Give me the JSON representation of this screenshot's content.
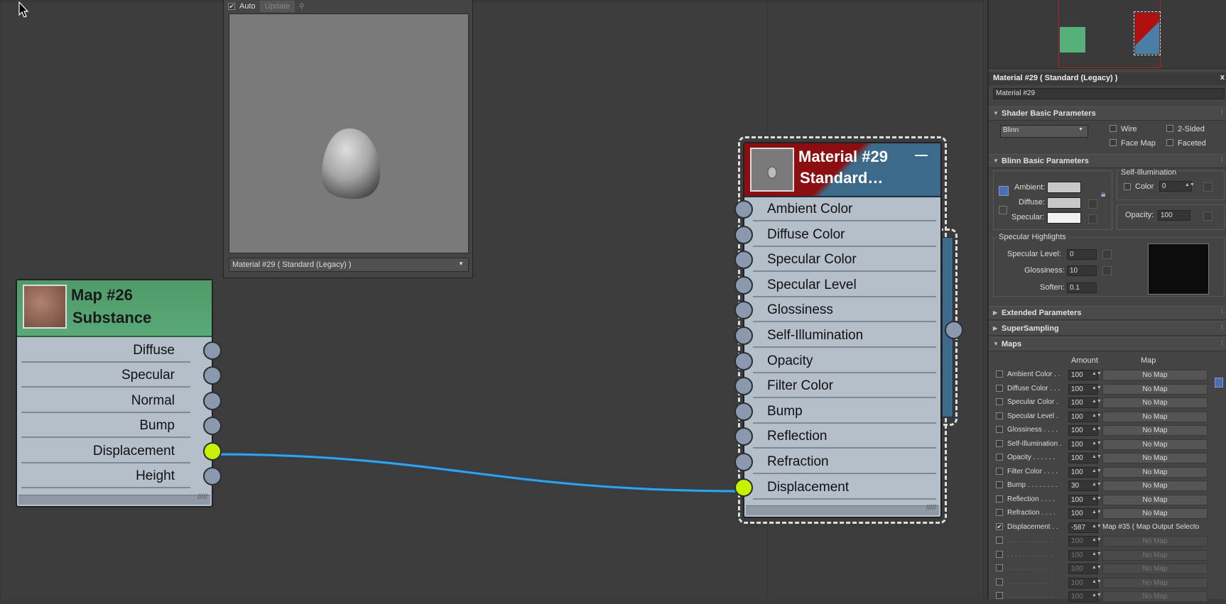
{
  "preview": {
    "auto_label": "Auto",
    "update_label": "Update",
    "material_select": "Material #29  ( Standard (Legacy) )"
  },
  "map_node": {
    "title_line1": "Map #26",
    "title_line2": "Substance",
    "outputs": [
      "Diffuse",
      "Specular",
      "Normal",
      "Bump",
      "Displacement",
      "Height"
    ],
    "active_output": "Displacement"
  },
  "material_node": {
    "title_line1": "Material #29",
    "title_line2": "Standard…",
    "minimize": "—",
    "inputs": [
      "Ambient Color",
      "Diffuse Color",
      "Specular Color",
      "Specular Level",
      "Glossiness",
      "Self-Illumination",
      "Opacity",
      "Filter Color",
      "Bump",
      "Reflection",
      "Refraction",
      "Displacement"
    ],
    "active_input": "Displacement"
  },
  "panel": {
    "title": "Material #29  ( Standard (Legacy) )",
    "close": "x",
    "name_field": "Material #29",
    "shader_section": "Shader Basic Parameters",
    "shader_select": "Blinn",
    "wire": "Wire",
    "two_sided": "2-Sided",
    "face_map": "Face Map",
    "faceted": "Faceted",
    "blinn_section": "Blinn Basic Parameters",
    "self_illum_group": "Self-Illumination",
    "ambient": "Ambient:",
    "diffuse": "Diffuse:",
    "specular": "Specular:",
    "color": "Color",
    "color_value": "0",
    "opacity": "Opacity:",
    "opacity_value": "100",
    "spec_highlights": "Specular Highlights",
    "spec_level": "Specular Level:",
    "spec_level_value": "0",
    "glossiness": "Glossiness:",
    "glossiness_value": "10",
    "soften": "Soften:",
    "soften_value": "0.1",
    "extended_section": "Extended Parameters",
    "supersampling_section": "SuperSampling",
    "maps_section": "Maps",
    "amount_header": "Amount",
    "map_header": "Map",
    "maps": [
      {
        "label": "Ambient Color . .",
        "amount": "100",
        "map": "No Map",
        "checked": false
      },
      {
        "label": "Diffuse Color . . .",
        "amount": "100",
        "map": "No Map",
        "checked": false
      },
      {
        "label": "Specular Color  .",
        "amount": "100",
        "map": "No Map",
        "checked": false
      },
      {
        "label": "Specular Level  .",
        "amount": "100",
        "map": "No Map",
        "checked": false
      },
      {
        "label": "Glossiness  . . . .",
        "amount": "100",
        "map": "No Map",
        "checked": false
      },
      {
        "label": "Self-Illumination .",
        "amount": "100",
        "map": "No Map",
        "checked": false
      },
      {
        "label": "Opacity . . . . . .",
        "amount": "100",
        "map": "No Map",
        "checked": false
      },
      {
        "label": "Filter Color  . . . .",
        "amount": "100",
        "map": "No Map",
        "checked": false
      },
      {
        "label": "Bump  . . . . . . . .",
        "amount": "30",
        "map": "No Map",
        "checked": false
      },
      {
        "label": "Reflection  . . . .",
        "amount": "100",
        "map": "No Map",
        "checked": false
      },
      {
        "label": "Refraction  . . . .",
        "amount": "100",
        "map": "No Map",
        "checked": false
      },
      {
        "label": "Displacement . .",
        "amount": "-587",
        "map": "Map #35  ( Map Output Selecto",
        "checked": true
      },
      {
        "label": ". . . . . . . . . . . .",
        "amount": "100",
        "map": "No Map",
        "checked": false,
        "dim": true
      },
      {
        "label": ". . . . . . . . . . . .",
        "amount": "100",
        "map": "No Map",
        "checked": false,
        "dim": true
      },
      {
        "label": ". . . . . . . . . . . .",
        "amount": "100",
        "map": "No Map",
        "checked": false,
        "dim": true
      },
      {
        "label": ". . . . . . . . . . . .",
        "amount": "100",
        "map": "No Map",
        "checked": false,
        "dim": true
      },
      {
        "label": ". . . . . . . . . . . .",
        "amount": "100",
        "map": "No Map",
        "checked": false,
        "dim": true
      }
    ]
  },
  "colors": {
    "map_header": "#55a473",
    "material_red": "#8b0f10",
    "material_blue": "#3c6a8a",
    "active_socket": "#c8f000",
    "wire": "#3aa0e0"
  }
}
